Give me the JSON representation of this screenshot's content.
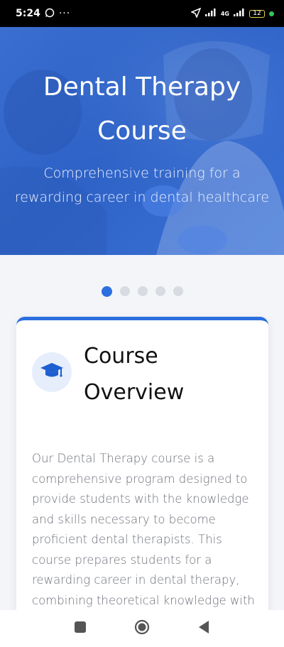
{
  "status_bar": {
    "time": "5:24",
    "network": "4G",
    "battery": "12"
  },
  "hero": {
    "title": "Dental Therapy Course",
    "subtitle": "Comprehensive training for a rewarding career in dental healthcare"
  },
  "carousel": {
    "pages": 5,
    "active_index": 0
  },
  "overview": {
    "icon": "graduation-cap-icon",
    "title": "Course Overview",
    "body": "Our Dental Therapy course is a comprehensive program designed to provide students with the knowledge and skills necessary to become proficient dental therapists. This course prepares students for a rewarding career in dental therapy, combining theoretical knowledge with hands-on"
  },
  "nav": {
    "items": [
      "square-icon",
      "home-circle-icon",
      "back-triangle-icon"
    ]
  },
  "colors": {
    "accent": "#2b6fe0",
    "hero_bg": "#3a6fd0"
  }
}
